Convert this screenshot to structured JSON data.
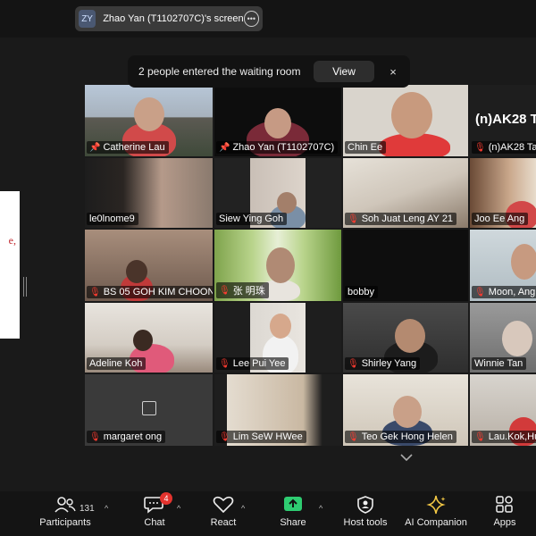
{
  "screen_share": {
    "initials": "ZY",
    "title": "Zhao Yan (T1102707C)'s screen"
  },
  "waiting_room": {
    "message": "2 people entered the waiting room",
    "view_label": "View",
    "close_glyph": "×"
  },
  "left_doc_text": "e,",
  "tiles": [
    {
      "name": "Catherine Lau",
      "pinned": true,
      "muted": false
    },
    {
      "name": "Zhao Yan (T1102707C)",
      "pinned": true,
      "muted": false,
      "active_speaker": true
    },
    {
      "name": "Chin Ee",
      "muted": false
    },
    {
      "name": "(n)AK28 Ta",
      "muted": true,
      "header": "(n)AK28 T"
    },
    {
      "name": "le0lnome9",
      "muted": false
    },
    {
      "name": "Siew Ying Goh",
      "muted": false
    },
    {
      "name": "Soh Juat Leng AY 21",
      "muted": true
    },
    {
      "name": "Joo Ee Ang",
      "muted": false
    },
    {
      "name": "BS 05 GOH KIM CHOON",
      "muted": true
    },
    {
      "name": "张 明珠",
      "muted": true
    },
    {
      "name": "bobby",
      "muted": false
    },
    {
      "name": "Moon, Ang",
      "muted": true
    },
    {
      "name": "Adeline Koh",
      "muted": false
    },
    {
      "name": "Lee Pui Yee",
      "muted": true
    },
    {
      "name": "Shirley Yang",
      "muted": true
    },
    {
      "name": "Winnie Tan",
      "muted": false
    },
    {
      "name": "margaret ong",
      "muted": true
    },
    {
      "name": "Lim SeW HWee",
      "muted": true
    },
    {
      "name": "Teo Gek Hong Helen",
      "muted": true
    },
    {
      "name": "Lau.Kok,Hu",
      "muted": true
    }
  ],
  "toolbar": {
    "participants_label": "Participants",
    "participants_count": "131",
    "chat_label": "Chat",
    "chat_badge": "4",
    "react_label": "React",
    "share_label": "Share",
    "host_tools_label": "Host tools",
    "ai_label": "AI Companion",
    "apps_label": "Apps"
  },
  "colors": {
    "active_border": "#2ecc71",
    "muted_icon": "#ff3b30",
    "share_green": "#2ecc71",
    "badge_red": "#e4332e"
  }
}
